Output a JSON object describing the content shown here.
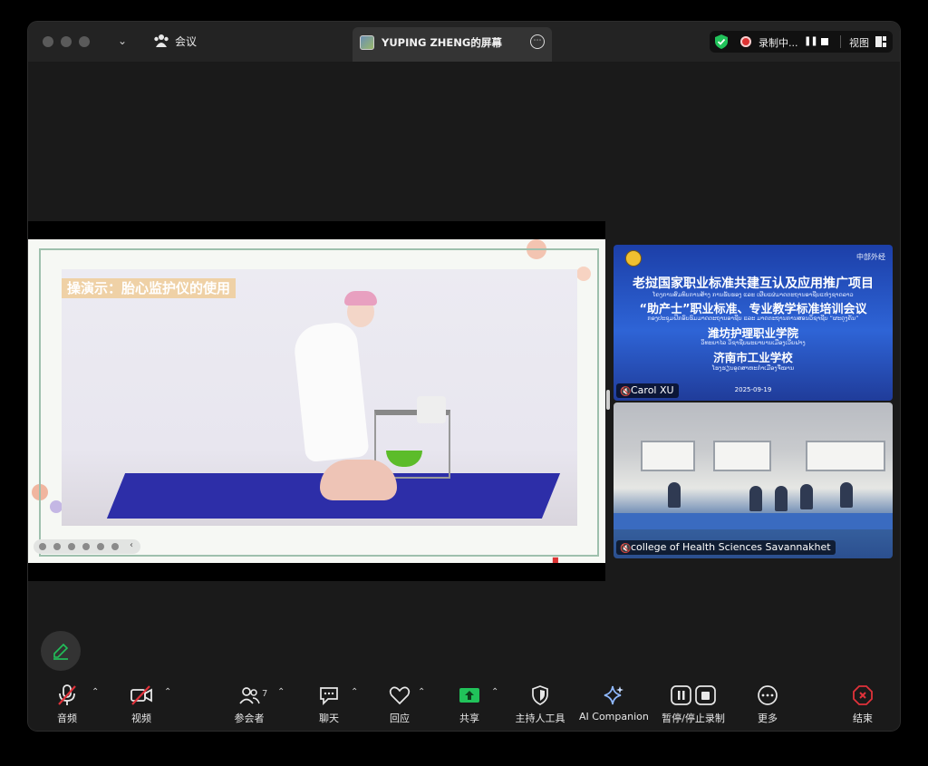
{
  "titlebar": {
    "meeting_label": "会议",
    "share_title": "YUPING ZHENG的屏幕",
    "recording_label": "录制中...",
    "view_label": "视图"
  },
  "slide": {
    "caption": "操演示：胎心监护仪的使用"
  },
  "gallery": {
    "banner": {
      "logo_right": "中部外经",
      "line1": "老挝国家职业标准共建互认及应用推广项目",
      "line1_sub": "ໂຄງການສົມທົບການສ້າງ ການຮັບຮອງ ແລະ ເຜີຍແຜ່ມາດຕະຖານອາຊີບແຫ່ງຊາດລາວ",
      "line2": "“助产士”职业标准、专业教学标准培训会议",
      "line2_sub": "ກອງປະຊຸມຝຶກອົບຮົມມາດຕະຖານອາຊີບ ແລະ ມາດຕະຖານການສອນວິຊາຊີບ “ຜະດຸງຄັນ”",
      "line3": "潍坊护理职业学院",
      "line3_sub": "ວິທະຍາໄລ ວິຊາຊີບພະຍາບານເມືອງເວີຍຟາງ",
      "line4": "济南市工业学校",
      "line4_sub": "ໂຮງຮຽນອຸດສາຫະກຳເມືອງຈີ່ໜານ",
      "date": "2025-09-19"
    },
    "tile1_name": "Carol XU",
    "tile2_name": "college of Health Sciences Savannakhet"
  },
  "toolbar": {
    "audio": "音频",
    "video": "视频",
    "participants": "参会者",
    "participant_count": "7",
    "chat": "聊天",
    "react": "回应",
    "share": "共享",
    "host_tools": "主持人工具",
    "ai_companion": "AI Companion",
    "pause_stop_recording": "暂停/停止录制",
    "more": "更多",
    "end": "结束"
  },
  "colors": {
    "share_green": "#21c25a",
    "end_red": "#e0323a",
    "mute_red": "#e0323a",
    "banner_blue": "#2452c4"
  }
}
